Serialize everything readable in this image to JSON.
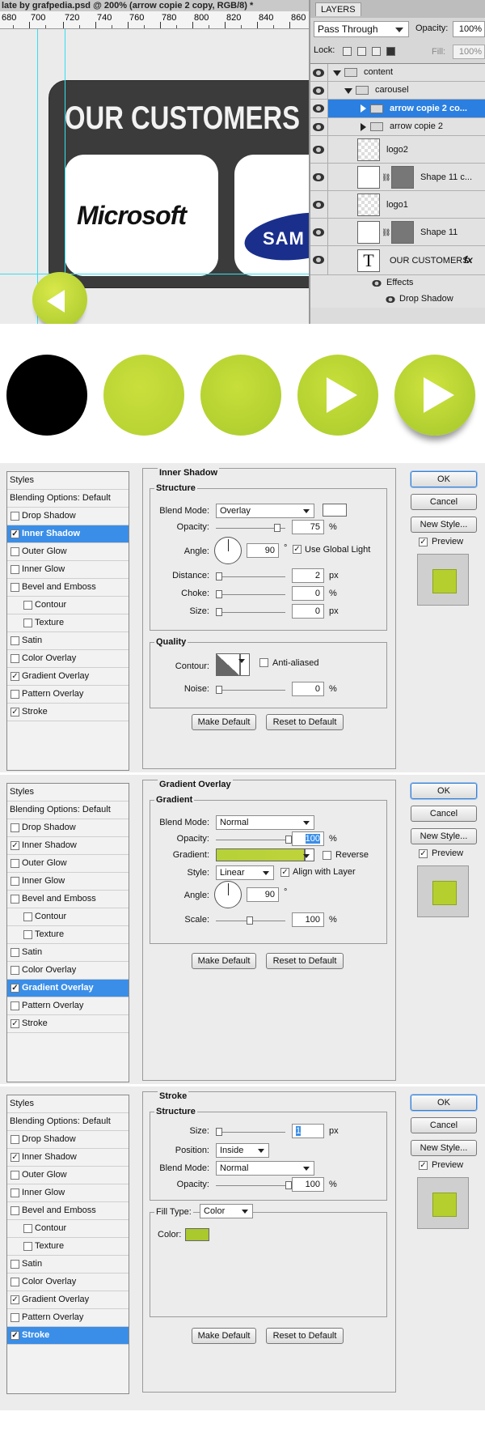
{
  "photoshop": {
    "doc_title": "late by grafpedia.psd @ 200% (arrow copie 2 copy, RGB/8) *",
    "ruler_ticks": [
      "680",
      "700",
      "720",
      "740",
      "760",
      "780",
      "800",
      "820",
      "840",
      "860"
    ],
    "canvas": {
      "heading": "OUR CUSTOMERS",
      "logo_left": "Microsoft",
      "logo_right": "SAM"
    }
  },
  "layers_panel": {
    "tab": "LAYERS",
    "blend_mode": "Pass Through",
    "opacity_label": "Opacity:",
    "opacity_value": "100%",
    "lock_label": "Lock:",
    "fill_label": "Fill:",
    "fill_value": "100%",
    "layers": [
      {
        "name": "content",
        "kind": "folder"
      },
      {
        "name": "carousel",
        "kind": "folder"
      },
      {
        "name": "arrow copie 2 co...",
        "kind": "folder",
        "selected": true
      },
      {
        "name": "arrow copie 2",
        "kind": "folder"
      },
      {
        "name": "logo2",
        "kind": "layer"
      },
      {
        "name": "Shape 11 c...",
        "kind": "shape"
      },
      {
        "name": "logo1",
        "kind": "layer"
      },
      {
        "name": "Shape 11",
        "kind": "shape"
      },
      {
        "name": "OUR CUSTOMERS",
        "kind": "text",
        "fx": "fx"
      },
      {
        "name": "Effects",
        "kind": "effects"
      },
      {
        "name": "Drop Shadow",
        "kind": "effect"
      }
    ]
  },
  "circles": {
    "colors": [
      "#000000",
      "#c4dc37",
      "#b8d432",
      "#b8d432",
      "#bdd634"
    ]
  },
  "styles_list": {
    "title": "Styles",
    "blending": "Blending Options: Default",
    "items": [
      "Drop Shadow",
      "Inner Shadow",
      "Outer Glow",
      "Inner Glow",
      "Bevel and Emboss",
      "Contour",
      "Texture",
      "Satin",
      "Color Overlay",
      "Gradient Overlay",
      "Pattern Overlay",
      "Stroke"
    ]
  },
  "buttons": {
    "ok": "OK",
    "cancel": "Cancel",
    "new_style": "New Style...",
    "preview": "Preview",
    "make_default": "Make Default",
    "reset_default": "Reset to Default"
  },
  "inner_shadow": {
    "title": "Inner Shadow",
    "structure": "Structure",
    "blend_mode_label": "Blend Mode:",
    "blend_mode": "Overlay",
    "opacity_label": "Opacity:",
    "opacity": "75",
    "angle_label": "Angle:",
    "angle": "90",
    "global_light": "Use Global Light",
    "distance_label": "Distance:",
    "distance": "2",
    "choke_label": "Choke:",
    "choke": "0",
    "size_label": "Size:",
    "size": "0",
    "quality": "Quality",
    "contour_label": "Contour:",
    "anti_aliased": "Anti-aliased",
    "noise_label": "Noise:",
    "noise": "0",
    "pct": "%",
    "px": "px",
    "deg": "°"
  },
  "gradient_overlay": {
    "title": "Gradient Overlay",
    "section": "Gradient",
    "blend_mode_label": "Blend Mode:",
    "blend_mode": "Normal",
    "opacity_label": "Opacity:",
    "opacity": "100",
    "gradient_label": "Gradient:",
    "reverse": "Reverse",
    "style_label": "Style:",
    "style": "Linear",
    "align": "Align with Layer",
    "angle_label": "Angle:",
    "angle": "90",
    "scale_label": "Scale:",
    "scale": "100",
    "pct": "%",
    "deg": "°"
  },
  "stroke": {
    "title": "Stroke",
    "structure": "Structure",
    "size_label": "Size:",
    "size": "1",
    "position_label": "Position:",
    "position": "Inside",
    "blend_mode_label": "Blend Mode:",
    "blend_mode": "Normal",
    "opacity_label": "Opacity:",
    "opacity": "100",
    "fill_type_label": "Fill Type:",
    "fill_type": "Color",
    "color_label": "Color:",
    "color": "#a9c92c",
    "pct": "%",
    "px": "px"
  }
}
